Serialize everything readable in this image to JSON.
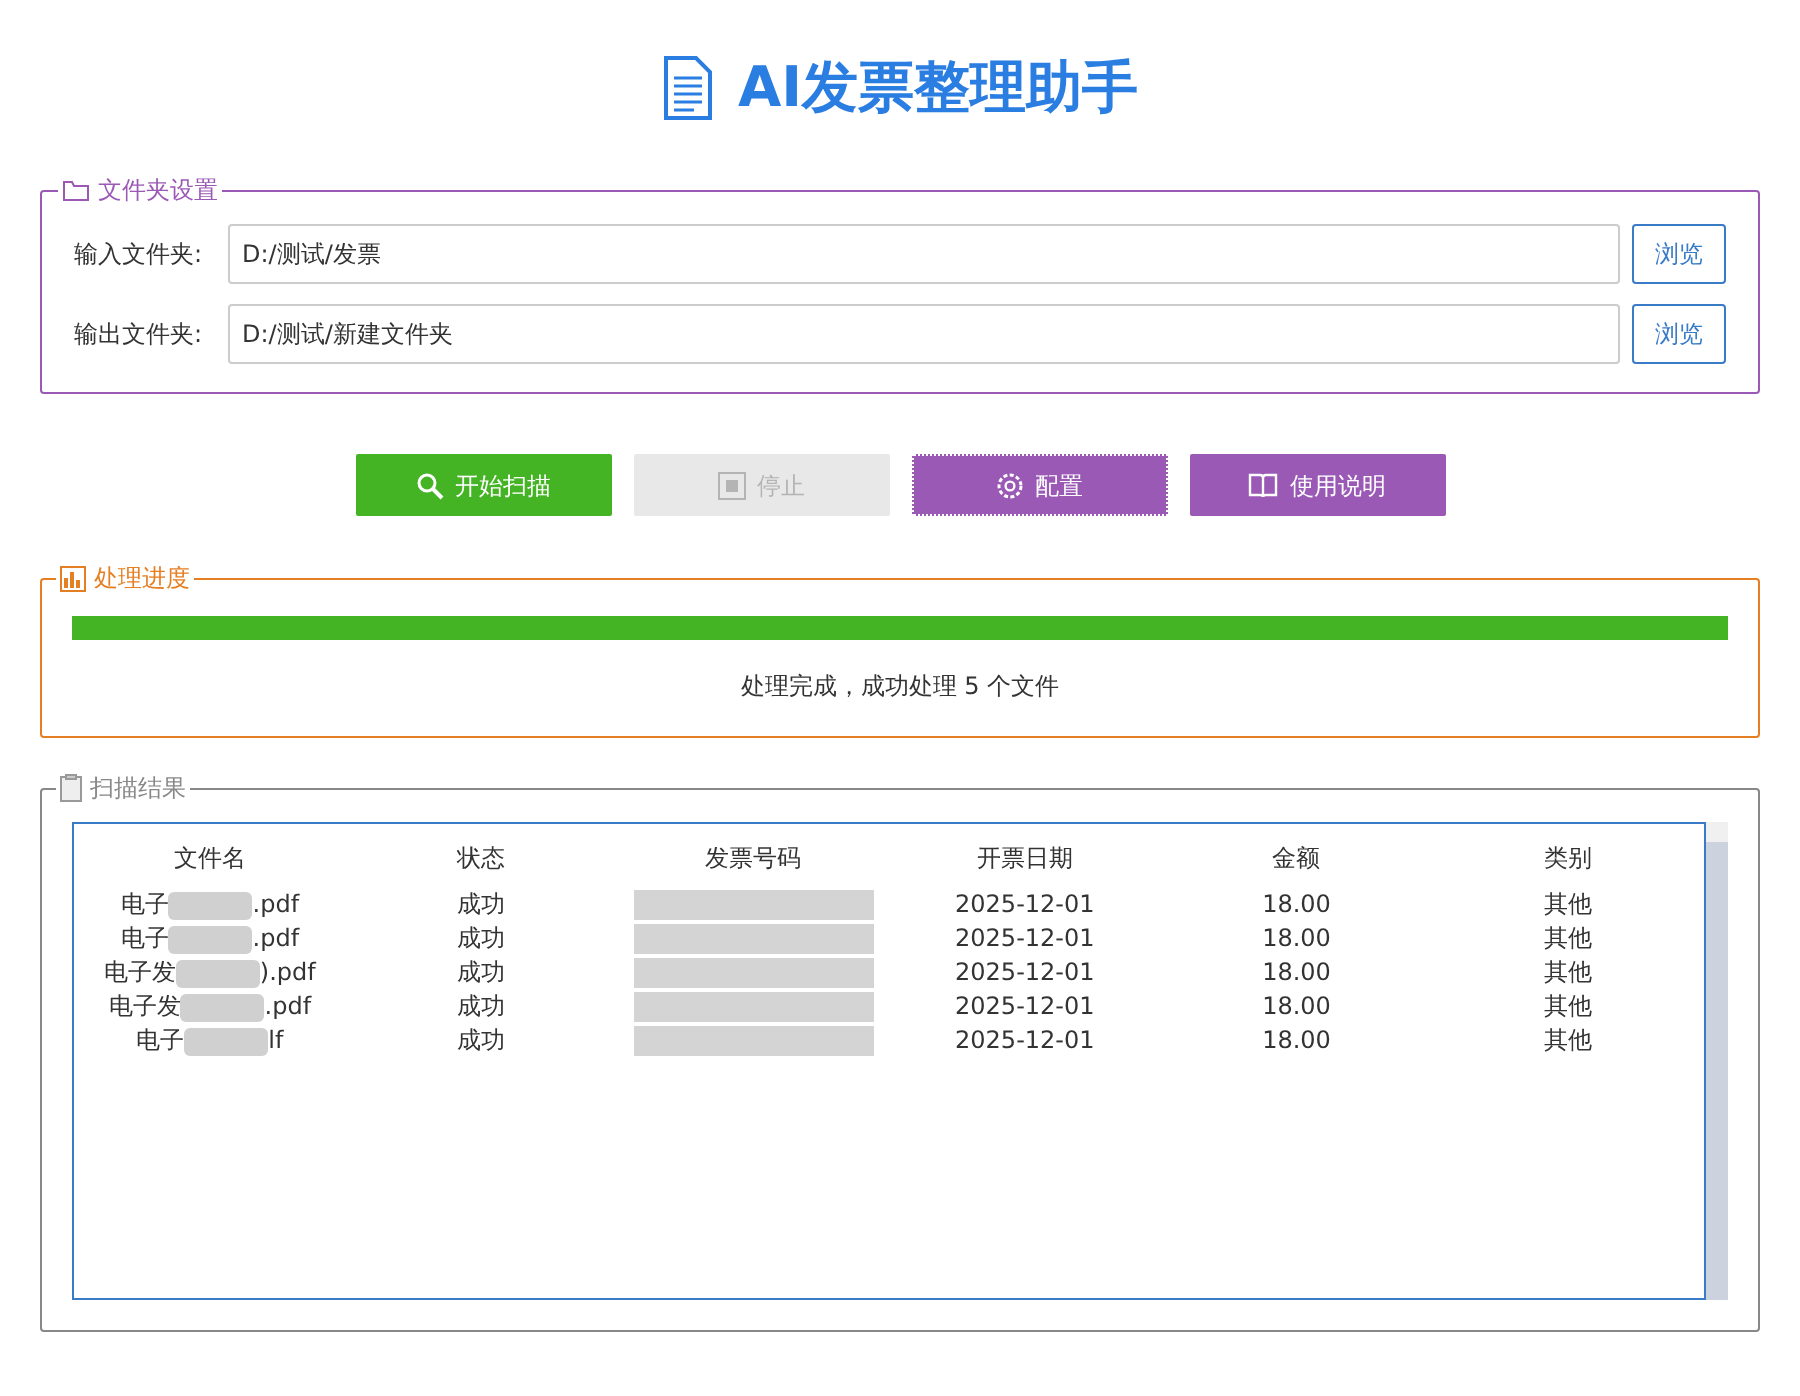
{
  "title": "AI发票整理助手",
  "folder_settings": {
    "legend": "文件夹设置",
    "rows": [
      {
        "label": "输入文件夹:",
        "value": "D:/测试/发票",
        "button": "浏览"
      },
      {
        "label": "输出文件夹:",
        "value": "D:/测试/新建文件夹",
        "button": "浏览"
      }
    ]
  },
  "actions": [
    {
      "label": "开始扫描",
      "color": "#44b424",
      "disabled": false,
      "focused": false
    },
    {
      "label": "停止",
      "color": "#e8e8e8",
      "disabled": true,
      "focused": false
    },
    {
      "label": "配置",
      "color": "#9b59b6",
      "disabled": false,
      "focused": true
    },
    {
      "label": "使用说明",
      "color": "#9b59b6",
      "disabled": false,
      "focused": false
    }
  ],
  "progress": {
    "legend": "处理进度",
    "level": 1,
    "message": "处理完成，成功处理 5 个文件"
  },
  "results": {
    "legend": "扫描结果",
    "columns": [
      "文件名",
      "状态",
      "发票号码",
      "开票日期",
      "金额",
      "类别"
    ],
    "rows": [
      {
        "file_name_start": "电子",
        "file_name_end": ".pdf",
        "status": "成功",
        "date": "2025-12-01",
        "amount": "18.00",
        "category": "其他"
      },
      {
        "file_name_start": "电子",
        "file_name_end": ".pdf",
        "status": "成功",
        "date": "2025-12-01",
        "amount": "18.00",
        "category": "其他"
      },
      {
        "file_name_start": "电子发",
        "file_name_end": ").pdf",
        "status": "成功",
        "date": "2025-12-01",
        "amount": "18.00",
        "category": "其他"
      },
      {
        "file_name_start": "电子发",
        "file_name_end": ".pdf",
        "status": "成功",
        "date": "2025-12-01",
        "amount": "18.00",
        "category": "其他"
      },
      {
        "file_name_start": "电子",
        "file_name_end": "lf",
        "status": "成功",
        "date": "2025-12-01",
        "amount": "18.00",
        "category": "其他"
      }
    ]
  }
}
